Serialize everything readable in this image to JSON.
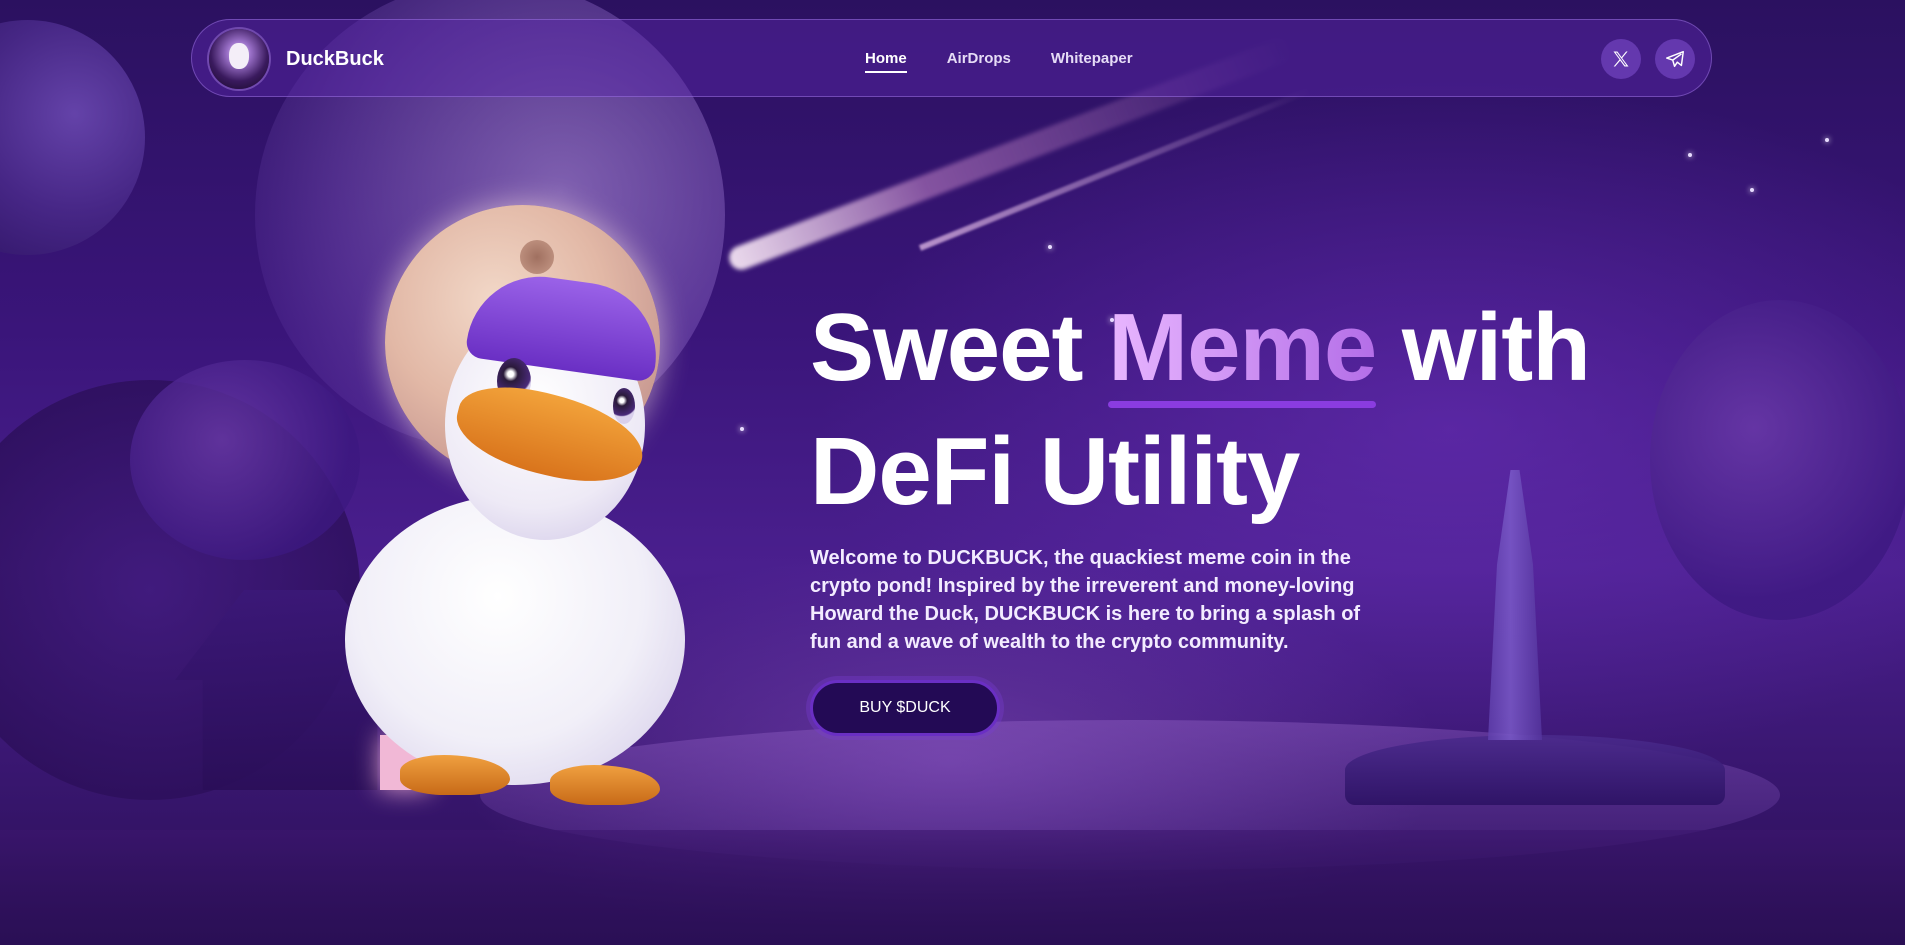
{
  "nav": {
    "brand_name": "DuckBuck",
    "links": [
      {
        "label": "Home",
        "active": true
      },
      {
        "label": "AirDrops",
        "active": false
      },
      {
        "label": "Whitepaper",
        "active": false
      }
    ],
    "socials": [
      {
        "icon": "x-twitter-icon"
      },
      {
        "icon": "telegram-icon"
      }
    ]
  },
  "hero": {
    "headline_part1": "Sweet ",
    "headline_highlight": "Meme",
    "headline_part2": " with",
    "headline_line2": "DeFi Utility",
    "description": "Welcome to DUCKBUCK, the quackiest meme coin in the crypto pond! Inspired by the irreverent and money-loving Howard the Duck, DUCKBUCK is here to bring a splash of fun and a wave of wealth to the crypto community.",
    "cta_label": "BUY $DUCK"
  },
  "colors": {
    "accent": "#8a3ce0",
    "highlight_text": "#c98bf4",
    "button_bg": "#230a55",
    "background": "#3a157a"
  }
}
